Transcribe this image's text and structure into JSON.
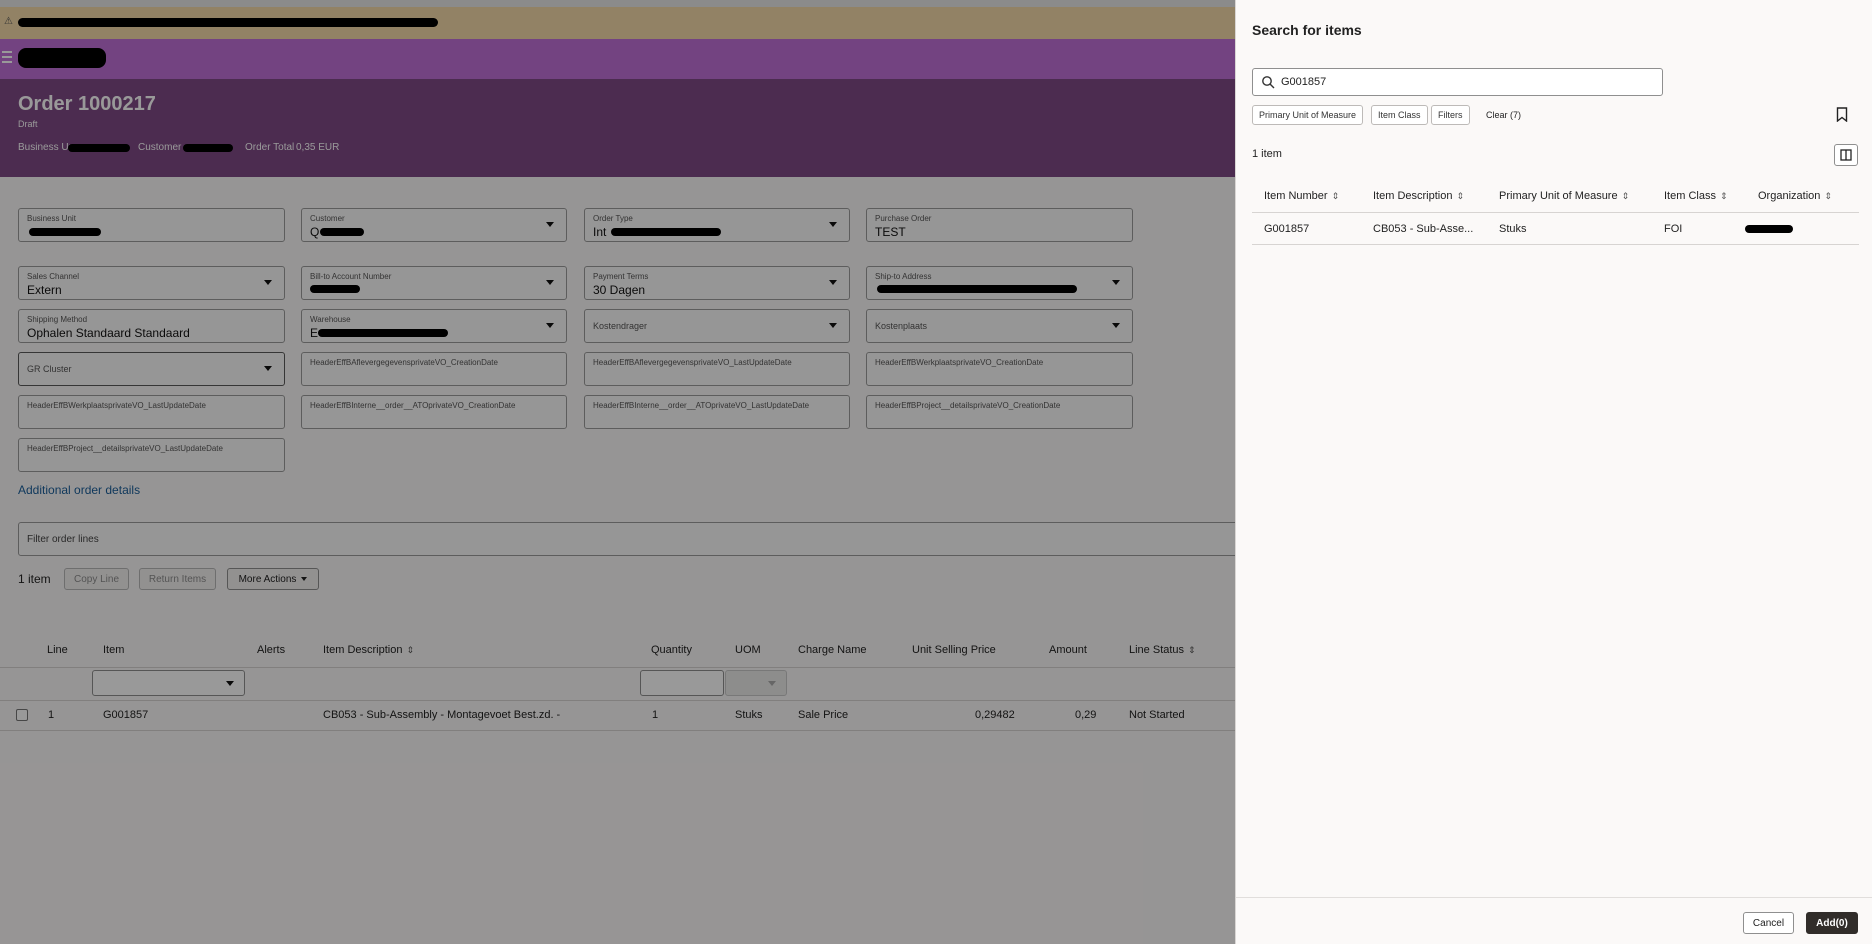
{
  "order": {
    "title": "Order 1000217",
    "status": "Draft",
    "business_unit_label": "Business Ur",
    "customer_label": "Customer",
    "order_total_label": "Order Total",
    "order_total_value": "0,35 EUR"
  },
  "form": {
    "business_unit_label": "Business Unit",
    "customer_label": "Customer",
    "customer_value": "Q",
    "order_type_label": "Order Type",
    "order_type_value": "Int",
    "purchase_order_label": "Purchase Order",
    "purchase_order_value": "TEST",
    "sales_channel_label": "Sales Channel",
    "sales_channel_value": "Extern",
    "bill_to_label": "Bill-to Account Number",
    "payment_terms_label": "Payment Terms",
    "payment_terms_value": "30 Dagen",
    "ship_to_label": "Ship-to Address",
    "shipping_method_label": "Shipping Method",
    "shipping_method_value": "Ophalen Standaard Standaard",
    "warehouse_label": "Warehouse",
    "warehouse_value": "E",
    "kostendrager_label": "Kostendrager",
    "kostenplaats_label": "Kostenplaats",
    "gr_cluster_label": "GR Cluster",
    "eff1_label": "HeaderEffBAflevergegevensprivateVO_CreationDate",
    "eff2_label": "HeaderEffBAflevergegevensprivateVO_LastUpdateDate",
    "eff3_label": "HeaderEffBWerkplaatsprivateVO_CreationDate",
    "eff4_label": "HeaderEffBWerkplaatsprivateVO_LastUpdateDate",
    "eff5_label": "HeaderEffBInterne__order__ATOprivateVO_CreationDate",
    "eff6_label": "HeaderEffBInterne__order__ATOprivateVO_LastUpdateDate",
    "eff7_label": "HeaderEffBProject__detailsprivateVO_CreationDate",
    "eff8_label": "HeaderEffBProject__detailsprivateVO_LastUpdateDate",
    "additional_details_link": "Additional order details"
  },
  "lines": {
    "filter_placeholder": "Filter order lines",
    "count": "1 item",
    "copy_line": "Copy Line",
    "return_items": "Return Items",
    "more_actions": "More Actions",
    "columns": {
      "line": "Line",
      "item": "Item",
      "alerts": "Alerts",
      "item_description": "Item Description",
      "quantity": "Quantity",
      "uom": "UOM",
      "charge_name": "Charge Name",
      "unit_selling_price": "Unit Selling Price",
      "amount": "Amount",
      "line_status": "Line Status"
    },
    "row": {
      "line": "1",
      "item": "G001857",
      "item_description": "CB053 - Sub-Assembly - Montagevoet Best.zd. -",
      "quantity": "1",
      "uom": "Stuks",
      "charge_name": "Sale Price",
      "unit_selling_price": "0,29482",
      "amount": "0,29",
      "line_status": "Not Started"
    }
  },
  "drawer": {
    "title": "Search for items",
    "search_value": "G001857",
    "chips": [
      "Primary Unit of Measure",
      "Item Class",
      "Filters"
    ],
    "clear_label": "Clear (7)",
    "count": "1 item",
    "columns": {
      "item_number": "Item Number",
      "item_description": "Item Description",
      "primary_uom": "Primary Unit of Measure",
      "item_class": "Item Class",
      "organization": "Organization"
    },
    "row": {
      "item_number": "G001857",
      "item_description": "CB053 - Sub-Asse...",
      "primary_uom": "Stuks",
      "item_class": "FOI"
    },
    "cancel_label": "Cancel",
    "add_label": "Add(0)"
  },
  "colors": {
    "brand": "#c070d8",
    "header_band": "#7f4a86",
    "warning_bar": "#f3d9a8",
    "link": "#1a5e9a",
    "primary_button": "#312d2a"
  }
}
